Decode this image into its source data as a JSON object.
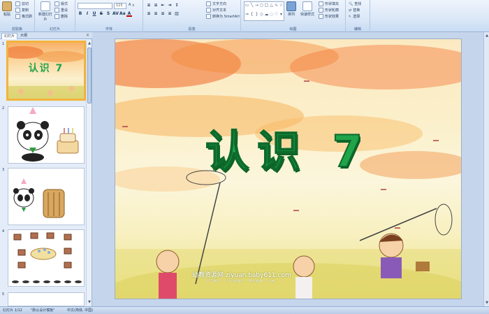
{
  "ribbon": {
    "groups": [
      "剪贴板",
      "幻灯片",
      "字体",
      "段落",
      "绘图",
      "编辑"
    ],
    "clipboard": {
      "paste": "粘贴",
      "cut": "剪切",
      "copy": "复制",
      "format_painter": "格式刷"
    },
    "slides": {
      "new_slide": "新建幻灯片",
      "layout": "版式",
      "reset": "重设",
      "delete": "删除"
    },
    "font": {
      "font_name": "",
      "font_size": "115"
    },
    "paragraph": {
      "text_direction": "文字方向",
      "align_text": "对齐文本",
      "smartart": "转换为 SmartArt"
    },
    "drawing": {
      "arrange": "排列",
      "quick_styles": "快速样式",
      "shape_fill": "形状填充",
      "shape_outline": "形状轮廓",
      "shape_effects": "形状效果"
    },
    "editing": {
      "find": "查找",
      "replace": "替换",
      "select": "选择"
    }
  },
  "panel": {
    "tabs": [
      "幻灯片",
      "大纲"
    ],
    "close": "×",
    "slide_numbers": [
      "1",
      "2",
      "3",
      "4",
      "5"
    ],
    "thumb1_title": "认识 7"
  },
  "slide": {
    "title": "认识 7",
    "watermark": "幼教资源网 ziyuan.baby611.com",
    "watermark_sub": "PPT课件 · FLASH课件 · 教师故事 · 试卷"
  },
  "status": {
    "slide_info": "幻灯片 1/12",
    "theme": "\"默认设计模板\"",
    "language": "中文(简体, 中国)"
  },
  "colors": {
    "title_green": "#1fa44a",
    "selected_thumb": "#f3b33d",
    "ribbon_bg": "#dde9f8"
  }
}
